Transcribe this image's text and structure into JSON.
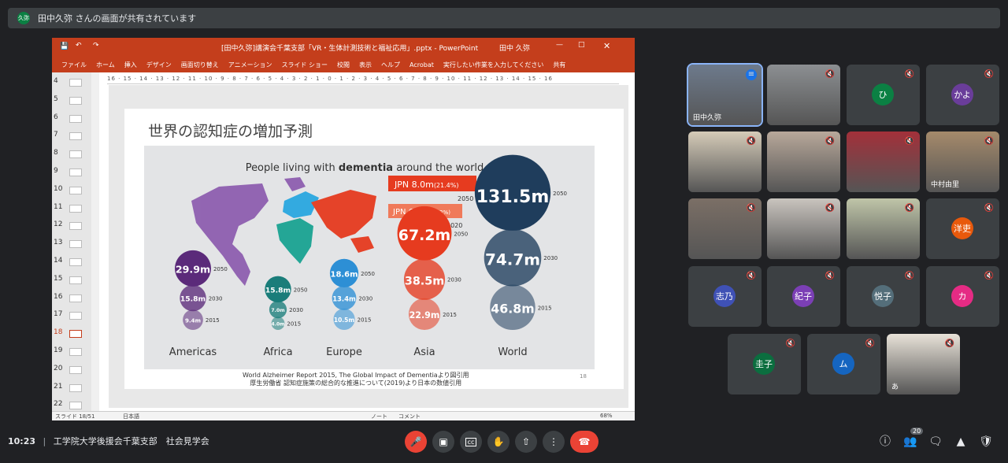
{
  "share_banner": {
    "avatar_initials": "久弥",
    "text": "田中久弥 さんの画面が共有されています"
  },
  "ppt": {
    "title": "[田中久弥]講演会千葉支部「VR・生体計測技術と福祉応用」.pptx  -  PowerPoint",
    "user": "田中 久弥",
    "ribbon_tabs": [
      "ファイル",
      "ホーム",
      "挿入",
      "デザイン",
      "画面切り替え",
      "アニメーション",
      "スライド ショー",
      "校閲",
      "表示",
      "ヘルプ",
      "Acrobat",
      "実行したい作業を入力してください",
      "共有"
    ],
    "thumb_numbers": [
      "4",
      "5",
      "6",
      "7",
      "8",
      "9",
      "10",
      "11",
      "12",
      "13",
      "14",
      "15",
      "16",
      "17",
      "18",
      "19",
      "20",
      "21",
      "22"
    ],
    "ruler": "16 · 15 · 14 · 13 · 12 · 11 · 10 · 9 · 8 · 7 · 6 · 5 · 4 · 3 · 2 · 1 · 0 · 1 · 2 · 3 · 4 · 5 · 6 · 7 · 8 · 9 · 10 · 11 · 12 · 13 · 14 · 15 · 16",
    "status": {
      "slide": "スライド 18/51",
      "lang": "日本語",
      "notes": "ノート",
      "comments": "コメント",
      "zoom": "68%"
    }
  },
  "slide": {
    "title": "世界の認知症の増加予測",
    "headline_pre": "People living with ",
    "headline_bold": "dementia",
    "headline_post": " around the world",
    "jpn_2050": "JPN 8.0m",
    "jpn_2050_pct": "(21.4%)",
    "jpn_2020": "JPN 6.0m",
    "jpn_2020_pct": "(17.2%)",
    "year_2050": "2050",
    "year_2020": "2020",
    "source_line1": "World Alzheimer Report 2015, The Global Impact of Dementiaより図引用",
    "source_line2": "厚生労働省 認知症施策の総合的な推進について(2019)より日本の数値引用",
    "slide_number": "18"
  },
  "chart_data": {
    "type": "bubble",
    "title": "People living with dementia around the world",
    "unit": "m",
    "years": [
      "2015",
      "2030",
      "2050"
    ],
    "series": [
      {
        "name": "Americas",
        "values": {
          "2015": 9.4,
          "2030": 15.8,
          "2050": 29.9
        },
        "color": "#5b2a7a"
      },
      {
        "name": "Africa",
        "values": {
          "2015": 4.0,
          "2030": 7.0,
          "2050": 15.8
        },
        "color": "#1a7d7a"
      },
      {
        "name": "Europe",
        "values": {
          "2015": 10.5,
          "2030": 13.4,
          "2050": 18.6
        },
        "color": "#2d8fd5"
      },
      {
        "name": "Asia",
        "values": {
          "2015": 22.9,
          "2030": 38.5,
          "2050": 67.2
        },
        "color": "#e63b1f"
      },
      {
        "name": "World",
        "values": {
          "2015": 46.8,
          "2030": 74.7,
          "2050": 131.5
        },
        "color": "#1f3d5c"
      }
    ],
    "labels": {
      "Americas": [
        "29.9m",
        "15.8m",
        "9.4m"
      ],
      "Africa": [
        "15.8m",
        "7.0m",
        "4.0m"
      ],
      "Europe": [
        "18.6m",
        "13.4m",
        "10.5m"
      ],
      "Asia": [
        "67.2m",
        "38.5m",
        "22.9m"
      ],
      "World": [
        "131.5m",
        "74.7m",
        "46.8m"
      ]
    }
  },
  "participants": [
    {
      "name": "田中久弥",
      "initial": "",
      "color": "",
      "muted": false,
      "photo": true
    },
    {
      "name": "",
      "initial": "",
      "color": "",
      "muted": true,
      "photo": true
    },
    {
      "name": "",
      "initial": "ひ",
      "color": "#0b8043",
      "muted": true,
      "photo": false
    },
    {
      "name": "",
      "initial": "かよ",
      "color": "#6a3d9a",
      "muted": true,
      "photo": false
    },
    {
      "name": "",
      "initial": "",
      "color": "",
      "muted": true,
      "photo": true
    },
    {
      "name": "",
      "initial": "",
      "color": "",
      "muted": true,
      "photo": true
    },
    {
      "name": "",
      "initial": "",
      "color": "",
      "muted": true,
      "photo": true
    },
    {
      "name": "中村由里",
      "initial": "",
      "color": "",
      "muted": true,
      "photo": true
    },
    {
      "name": "",
      "initial": "",
      "color": "",
      "muted": true,
      "photo": true
    },
    {
      "name": "",
      "initial": "",
      "color": "",
      "muted": true,
      "photo": true
    },
    {
      "name": "",
      "initial": "",
      "color": "",
      "muted": true,
      "photo": true
    },
    {
      "name": "",
      "initial": "洋吏",
      "color": "#e8590c",
      "muted": true,
      "photo": false
    },
    {
      "name": "",
      "initial": "志乃",
      "color": "#3f51b5",
      "muted": true,
      "photo": false
    },
    {
      "name": "",
      "initial": "紀子",
      "color": "#7b3fb5",
      "muted": true,
      "photo": false
    },
    {
      "name": "",
      "initial": "悦子",
      "color": "#546e7a",
      "muted": true,
      "photo": false
    },
    {
      "name": "",
      "initial": "カ",
      "color": "#e52b84",
      "muted": true,
      "photo": false
    },
    {
      "name": "",
      "initial": "圭子",
      "color": "#0b6e3f",
      "muted": true,
      "photo": false
    },
    {
      "name": "",
      "initial": "ム",
      "color": "#1565c0",
      "muted": true,
      "photo": false
    },
    {
      "name": "あ",
      "initial": "",
      "color": "",
      "muted": true,
      "photo": true
    }
  ],
  "bottom": {
    "time": "10:23",
    "separator": "|",
    "meeting": "工学院大学後援会千葉支部　社会見学会",
    "people_count": "20"
  }
}
